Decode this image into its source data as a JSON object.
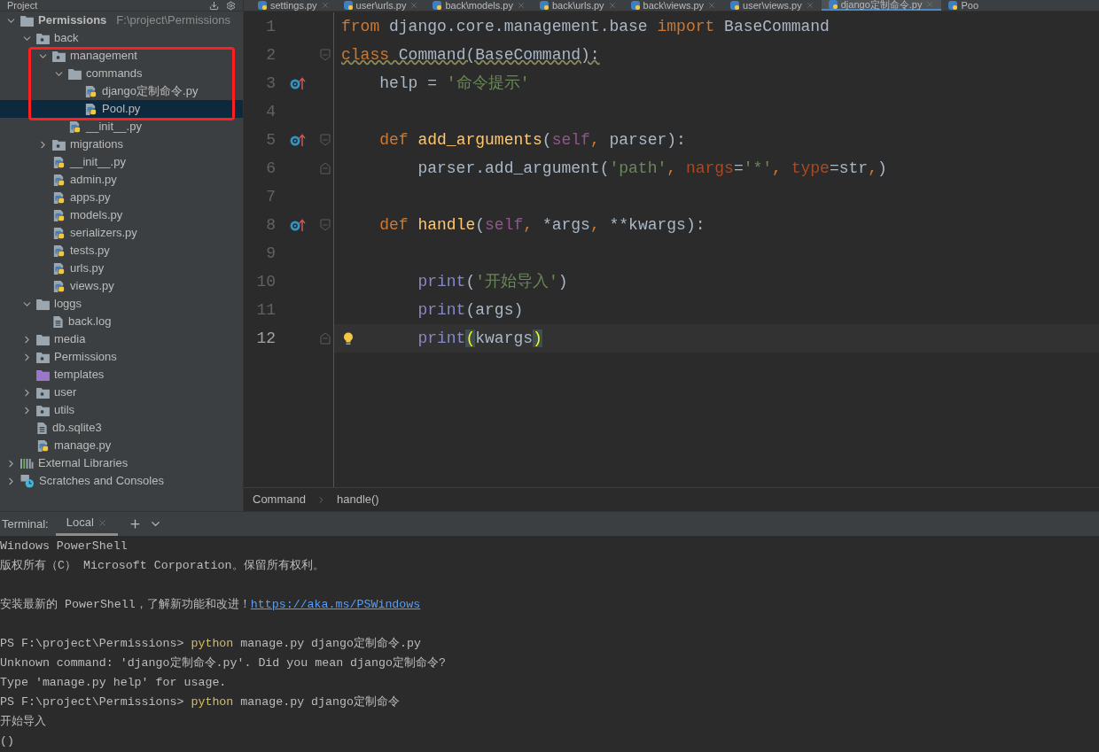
{
  "project_panel": {
    "title": "Project"
  },
  "tabs": [
    {
      "label": "settings.py",
      "selected": false
    },
    {
      "label": "user\\urls.py",
      "selected": false
    },
    {
      "label": "back\\models.py",
      "selected": false
    },
    {
      "label": "back\\urls.py",
      "selected": false
    },
    {
      "label": "back\\views.py",
      "selected": false
    },
    {
      "label": "user\\views.py",
      "selected": false
    },
    {
      "label": "django定制命令.py",
      "selected": true
    },
    {
      "label": "Poo",
      "selected": false
    }
  ],
  "tree": [
    {
      "label": "Permissions",
      "path": "F:\\project\\Permissions",
      "kind": "folder",
      "expanded": true,
      "selected": false,
      "children": [
        {
          "label": "back",
          "kind": "package",
          "expanded": true,
          "selected": false,
          "children": [
            {
              "label": "management",
              "kind": "package",
              "expanded": true,
              "selected": false,
              "children": [
                {
                  "label": "commands",
                  "kind": "folder",
                  "expanded": true,
                  "selected": false,
                  "children": [
                    {
                      "label": "django定制命令.py",
                      "kind": "python",
                      "selected": false
                    },
                    {
                      "label": "Pool.py",
                      "kind": "python",
                      "selected": true
                    }
                  ]
                },
                {
                  "label": "__init__.py",
                  "kind": "python",
                  "selected": false
                }
              ]
            },
            {
              "label": "migrations",
              "kind": "package",
              "expanded": false,
              "selected": false
            },
            {
              "label": "__init__.py",
              "kind": "python",
              "selected": false
            },
            {
              "label": "admin.py",
              "kind": "python",
              "selected": false
            },
            {
              "label": "apps.py",
              "kind": "python",
              "selected": false
            },
            {
              "label": "models.py",
              "kind": "python",
              "selected": false
            },
            {
              "label": "serializers.py",
              "kind": "python",
              "selected": false
            },
            {
              "label": "tests.py",
              "kind": "python",
              "selected": false
            },
            {
              "label": "urls.py",
              "kind": "python",
              "selected": false
            },
            {
              "label": "views.py",
              "kind": "python",
              "selected": false
            }
          ]
        },
        {
          "label": "loggs",
          "kind": "folder",
          "expanded": true,
          "selected": false,
          "children": [
            {
              "label": "back.log",
              "kind": "file",
              "selected": false
            }
          ]
        },
        {
          "label": "media",
          "kind": "folder",
          "expanded": false,
          "selected": false
        },
        {
          "label": "Permissions",
          "kind": "package",
          "expanded": false,
          "selected": false
        },
        {
          "label": "templates",
          "kind": "template-folder",
          "selected": false
        },
        {
          "label": "user",
          "kind": "package",
          "expanded": false,
          "selected": false
        },
        {
          "label": "utils",
          "kind": "package",
          "expanded": false,
          "selected": false
        },
        {
          "label": "db.sqlite3",
          "kind": "file",
          "selected": false
        },
        {
          "label": "manage.py",
          "kind": "python",
          "selected": false
        }
      ]
    },
    {
      "label": "External Libraries",
      "kind": "libraries",
      "expanded": false,
      "selected": false
    },
    {
      "label": "Scratches and Consoles",
      "kind": "scratches",
      "expanded": false,
      "selected": false
    }
  ],
  "editor": {
    "lines": [
      {
        "number": "1",
        "current": false,
        "tokens": [
          {
            "text": "from",
            "kind": "keyword"
          },
          {
            "text": " django.core.management.base ",
            "kind": "plain"
          },
          {
            "text": "import",
            "kind": "keyword"
          },
          {
            "text": " BaseCommand",
            "kind": "plain"
          }
        ]
      },
      {
        "number": "2",
        "current": false,
        "fold": {
          "kind": "start"
        },
        "tokens": [
          {
            "text": "class",
            "kind": "keyword-warn"
          },
          {
            "text": " Command(BaseCommand):",
            "kind": "plain-warn"
          }
        ]
      },
      {
        "number": "3",
        "current": false,
        "marker": {
          "kind": "override"
        },
        "tokens": [
          {
            "text": "    help = ",
            "kind": "plain"
          },
          {
            "text": "'命令提示'",
            "kind": "string"
          }
        ]
      },
      {
        "number": "4",
        "current": false
      },
      {
        "number": "5",
        "current": false,
        "marker": {
          "kind": "override"
        },
        "fold": {
          "kind": "start"
        },
        "tokens": [
          {
            "text": "    def ",
            "kind": "keyword"
          },
          {
            "text": "add_arguments",
            "kind": "function"
          },
          {
            "text": "(",
            "kind": "plain"
          },
          {
            "text": "self",
            "kind": "self"
          },
          {
            "text": ", ",
            "kind": "keyword"
          },
          {
            "text": "parser):",
            "kind": "plain"
          }
        ]
      },
      {
        "number": "6",
        "current": false,
        "fold": {
          "kind": "end"
        },
        "tokens": [
          {
            "text": "        parser.add_argument(",
            "kind": "plain"
          },
          {
            "text": "'path'",
            "kind": "string"
          },
          {
            "text": ", ",
            "kind": "keyword"
          },
          {
            "text": "nargs",
            "kind": "param"
          },
          {
            "text": "=",
            "kind": "plain"
          },
          {
            "text": "'*'",
            "kind": "string"
          },
          {
            "text": ", ",
            "kind": "keyword"
          },
          {
            "text": "type",
            "kind": "param"
          },
          {
            "text": "=str",
            "kind": "plain"
          },
          {
            "text": ",",
            "kind": "keyword"
          },
          {
            "text": ")",
            "kind": "plain"
          }
        ]
      },
      {
        "number": "7",
        "current": false
      },
      {
        "number": "8",
        "current": false,
        "marker": {
          "kind": "override"
        },
        "fold": {
          "kind": "start"
        },
        "tokens": [
          {
            "text": "    def ",
            "kind": "keyword"
          },
          {
            "text": "handle",
            "kind": "function"
          },
          {
            "text": "(",
            "kind": "plain"
          },
          {
            "text": "self",
            "kind": "self"
          },
          {
            "text": ", ",
            "kind": "keyword"
          },
          {
            "text": "*args",
            "kind": "plain"
          },
          {
            "text": ", ",
            "kind": "keyword"
          },
          {
            "text": "**kwargs):",
            "kind": "plain"
          }
        ]
      },
      {
        "number": "9",
        "current": false
      },
      {
        "number": "10",
        "current": false,
        "tokens": [
          {
            "text": "        print",
            "kind": "builtin"
          },
          {
            "text": "(",
            "kind": "plain"
          },
          {
            "text": "'开始导入'",
            "kind": "string"
          },
          {
            "text": ")",
            "kind": "plain"
          }
        ]
      },
      {
        "number": "11",
        "current": false,
        "tokens": [
          {
            "text": "        print",
            "kind": "builtin"
          },
          {
            "text": "(args)",
            "kind": "plain"
          }
        ]
      },
      {
        "number": "12",
        "current": true,
        "marker": {
          "kind": "bulb"
        },
        "fold": {
          "kind": "end"
        },
        "tokens": [
          {
            "text": "        print",
            "kind": "builtin"
          },
          {
            "text": "(",
            "kind": "brace-match"
          },
          {
            "text": "kwargs",
            "kind": "plain"
          },
          {
            "text": ")",
            "kind": "brace-match"
          }
        ]
      }
    ]
  },
  "breadcrumbs": [
    "Command",
    "handle()"
  ],
  "terminal": {
    "title": "Terminal:",
    "tab": "Local",
    "lines": [
      {
        "kind": "text",
        "segments": [
          {
            "text": "Windows PowerShell",
            "kind": "plain"
          }
        ]
      },
      {
        "kind": "text",
        "segments": [
          {
            "text": "版权所有（C） Microsoft Corporation。保留所有权利。",
            "kind": "plain"
          }
        ]
      },
      {
        "kind": "blank"
      },
      {
        "kind": "text",
        "segments": [
          {
            "text": "安装最新的 PowerShell，了解新功能和改进！",
            "kind": "plain"
          },
          {
            "text": "https://aka.ms/PSWindows",
            "kind": "link"
          }
        ]
      },
      {
        "kind": "blank"
      },
      {
        "kind": "text",
        "segments": [
          {
            "text": "PS F:\\project\\Permissions> ",
            "kind": "plain"
          },
          {
            "text": "python",
            "kind": "command"
          },
          {
            "text": " manage.py django定制命令.py",
            "kind": "plain"
          }
        ]
      },
      {
        "kind": "text",
        "segments": [
          {
            "text": "Unknown command: 'django定制命令.py'. Did you mean django定制命令?",
            "kind": "plain"
          }
        ]
      },
      {
        "kind": "text",
        "segments": [
          {
            "text": "Type 'manage.py help' for usage.",
            "kind": "plain"
          }
        ]
      },
      {
        "kind": "text",
        "segments": [
          {
            "text": "PS F:\\project\\Permissions> ",
            "kind": "plain"
          },
          {
            "text": "python",
            "kind": "command"
          },
          {
            "text": " manage.py django定制命令",
            "kind": "plain"
          }
        ]
      },
      {
        "kind": "text",
        "segments": [
          {
            "text": "开始导入",
            "kind": "plain"
          }
        ]
      },
      {
        "kind": "text",
        "segments": [
          {
            "text": "()",
            "kind": "plain"
          }
        ]
      }
    ]
  }
}
